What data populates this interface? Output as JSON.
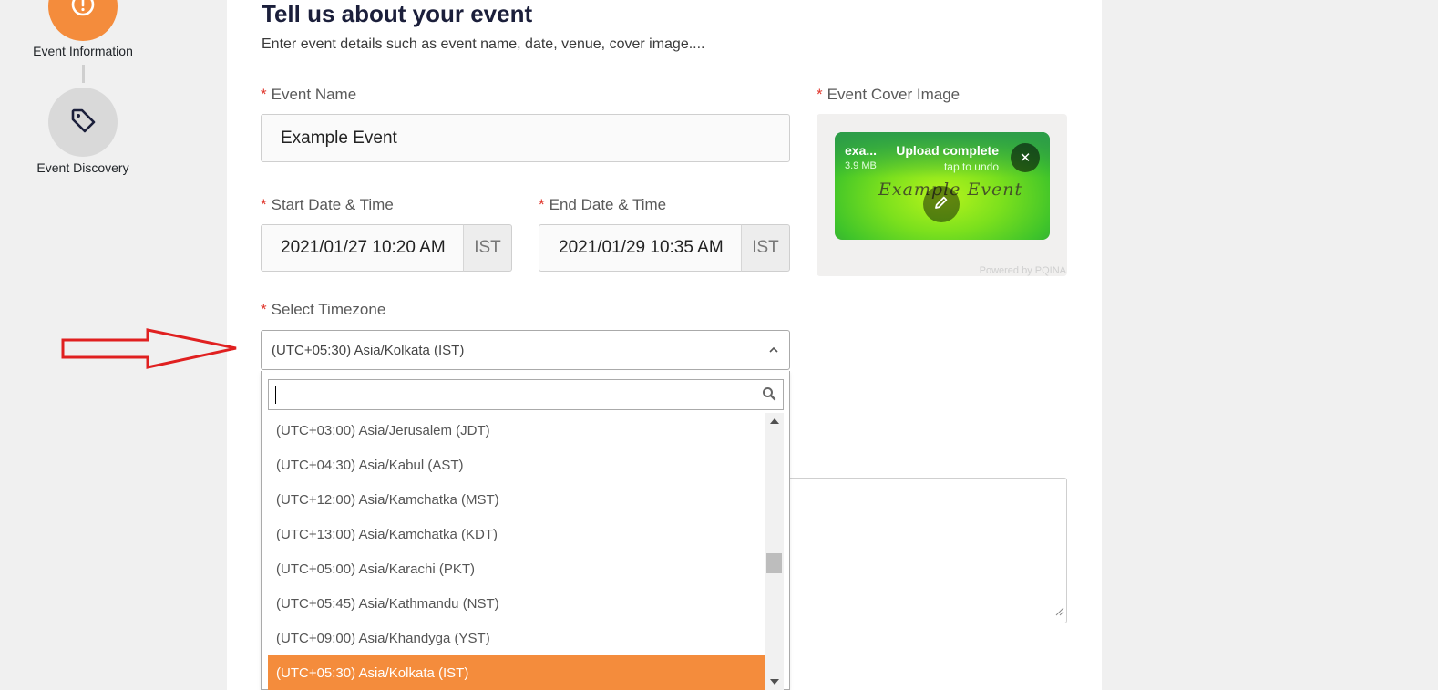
{
  "stepper": {
    "steps": [
      {
        "label": "Event Information",
        "icon": "alert-circle-icon",
        "state": "active",
        "color": "#f48c3c"
      },
      {
        "label": "Event Discovery",
        "icon": "tag-icon",
        "state": "inactive",
        "color": "#d9d9d9"
      }
    ]
  },
  "header": {
    "title": "Tell us about your event",
    "subtitle": "Enter event details such as event name, date, venue, cover image...."
  },
  "form": {
    "required_mark": "*",
    "event_name": {
      "label": "Event Name",
      "value": "Example Event"
    },
    "start": {
      "label": "Start Date & Time",
      "value": "2021/01/27 10:20 AM",
      "tz": "IST"
    },
    "end": {
      "label": "End Date & Time",
      "value": "2021/01/29 10:35 AM",
      "tz": "IST"
    },
    "timezone": {
      "label": "Select Timezone",
      "selected": "(UTC+05:30) Asia/Kolkata (IST)",
      "search_value": "",
      "options": [
        "(UTC+03:00) Asia/Jerusalem (JDT)",
        "(UTC+04:30) Asia/Kabul (AST)",
        "(UTC+12:00) Asia/Kamchatka (MST)",
        "(UTC+13:00) Asia/Kamchatka (KDT)",
        "(UTC+05:00) Asia/Karachi (PKT)",
        "(UTC+05:45) Asia/Kathmandu (NST)",
        "(UTC+09:00) Asia/Khandyga (YST)",
        "(UTC+05:30) Asia/Kolkata (IST)"
      ],
      "highlighted_index": 7
    },
    "cover": {
      "label": "Event Cover Image",
      "file_name": "exa...",
      "file_size": "3.9 MB",
      "status": "Upload complete",
      "undo_hint": "tap to undo",
      "image_text": "Example Event",
      "powered_by": "Powered by PQINA"
    }
  },
  "colors": {
    "accent": "#f48c3c",
    "required": "#e0352b",
    "upload_success": "#2d9d49",
    "arrow": "#e02020"
  }
}
